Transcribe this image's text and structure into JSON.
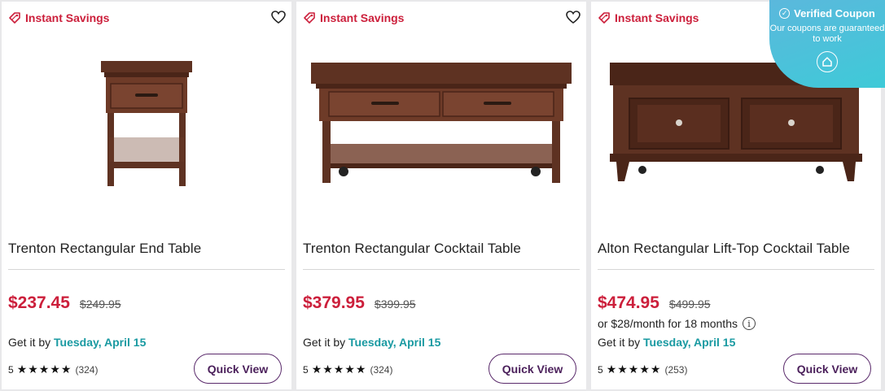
{
  "products": [
    {
      "badge": "Instant Savings",
      "title": "Trenton Rectangular End Table",
      "sale_price": "$237.45",
      "original_price": "$249.95",
      "financing": "",
      "delivery_label": "Get it by",
      "delivery_date": "Tuesday, April 15",
      "rating": "5",
      "stars": "★★★★★",
      "review_count": "(324)",
      "quick_view": "Quick View"
    },
    {
      "badge": "Instant Savings",
      "title": "Trenton Rectangular Cocktail Table",
      "sale_price": "$379.95",
      "original_price": "$399.95",
      "financing": "",
      "delivery_label": "Get it by",
      "delivery_date": "Tuesday, April 15",
      "rating": "5",
      "stars": "★★★★★",
      "review_count": "(324)",
      "quick_view": "Quick View"
    },
    {
      "badge": "Instant Savings",
      "title": "Alton Rectangular Lift-Top Cocktail Table",
      "sale_price": "$474.95",
      "original_price": "$499.95",
      "financing": "or $28/month for 18 months",
      "delivery_label": "Get it by",
      "delivery_date": "Tuesday, April 15",
      "rating": "5",
      "stars": "★★★★★",
      "review_count": "(253)",
      "quick_view": "Quick View"
    }
  ],
  "coupon_widget": {
    "title": "Verified Coupon",
    "message": "Our coupons are guaranteed to work"
  },
  "colors": {
    "sale": "#cc1f3b",
    "delivery_date": "#1a9aa2",
    "quick_view_border": "#5a2a6b",
    "coupon_bg": "#4ec3da",
    "wood": "#6e3b28"
  },
  "icons": [
    "tag-icon",
    "heart-icon",
    "info-icon",
    "check-circle-icon",
    "home-icon"
  ]
}
